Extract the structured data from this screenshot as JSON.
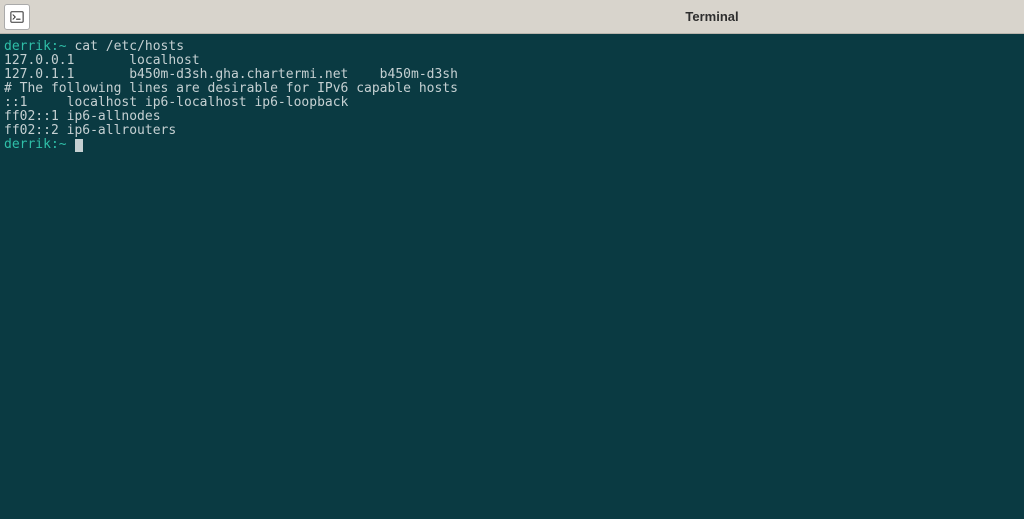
{
  "titlebar": {
    "title": "Terminal"
  },
  "prompt": {
    "user": "derrik",
    "sep": ":~",
    "command": "cat /etc/hosts"
  },
  "output": {
    "l1": "127.0.0.1       localhost",
    "l2": "127.0.1.1       b450m-d3sh.gha.chartermi.net    b450m-d3sh",
    "l3": "",
    "l4": "# The following lines are desirable for IPv6 capable hosts",
    "l5": "::1     localhost ip6-localhost ip6-loopback",
    "l6": "ff02::1 ip6-allnodes",
    "l7": "ff02::2 ip6-allrouters"
  },
  "prompt2": {
    "user": "derrik",
    "sep": ":~"
  }
}
